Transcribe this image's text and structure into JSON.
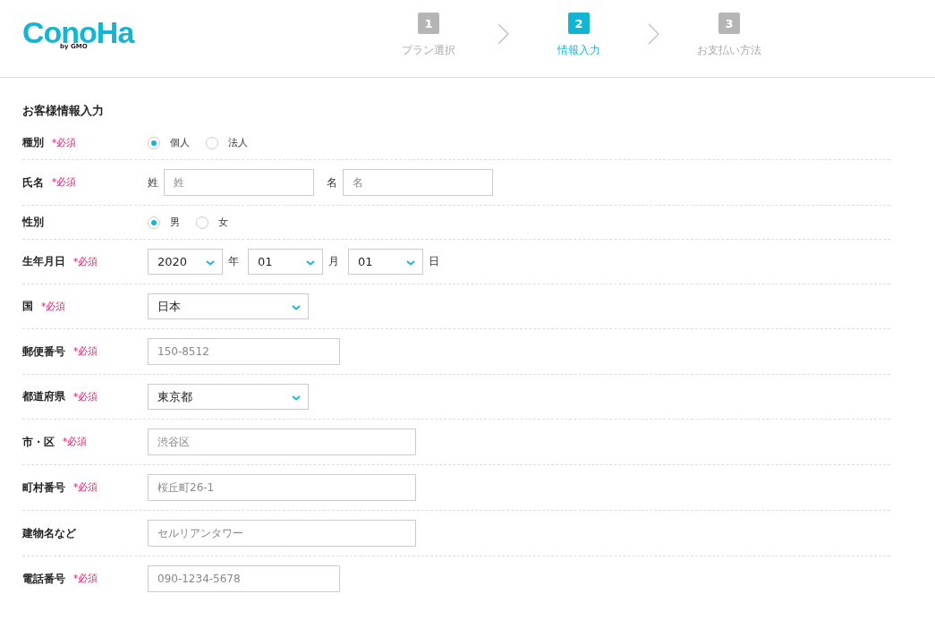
{
  "header": {
    "logo": {
      "text": "ConoHa",
      "sub": "by GMO"
    },
    "steps": [
      {
        "number": "1",
        "label": "プラン選択",
        "selected": false
      },
      {
        "number": "2",
        "label": "情報入力",
        "selected": true
      },
      {
        "number": "3",
        "label": "お支払い方法",
        "selected": false
      }
    ]
  },
  "form": {
    "title": "お客様情報入力",
    "rows": [
      {
        "label": "種別",
        "required": "*必須",
        "kind": "radio",
        "options": [
          {
            "label": "個人",
            "selected": true
          },
          {
            "label": "法人",
            "selected": false
          }
        ]
      },
      {
        "label": "氏名",
        "required": "*必須",
        "kind": "name",
        "fields": [
          {
            "prefix": "姓",
            "placeholder": "姓"
          },
          {
            "prefix": "名",
            "placeholder": "名"
          }
        ]
      },
      {
        "label": "性別",
        "kind": "radio",
        "options": [
          {
            "label": "男",
            "selected": true
          },
          {
            "label": "女",
            "selected": false
          }
        ]
      },
      {
        "label": "生年月日",
        "required": "*必須",
        "kind": "date",
        "selects": [
          {
            "value": "2020",
            "unit": "年"
          },
          {
            "value": "01",
            "unit": "月"
          },
          {
            "value": "01",
            "unit": "日"
          }
        ]
      },
      {
        "label": "国",
        "required": "*必須",
        "kind": "select",
        "value": "日本"
      },
      {
        "label": "郵便番号",
        "required": "*必須",
        "kind": "short",
        "placeholder": "150-8512"
      },
      {
        "label": "都道府県",
        "required": "*必須",
        "kind": "select",
        "value": "東京都"
      },
      {
        "label": "市・区",
        "required": "*必須",
        "kind": "long",
        "placeholder": "渋谷区"
      },
      {
        "label": "町村番号",
        "required": "*必須",
        "kind": "long",
        "placeholder": "桜丘町26-1"
      },
      {
        "label": "建物名など",
        "kind": "long",
        "placeholder": "セルリアンタワー"
      },
      {
        "label": "電話番号",
        "required": "*必須",
        "kind": "short",
        "placeholder": "090-1234-5678"
      }
    ]
  }
}
